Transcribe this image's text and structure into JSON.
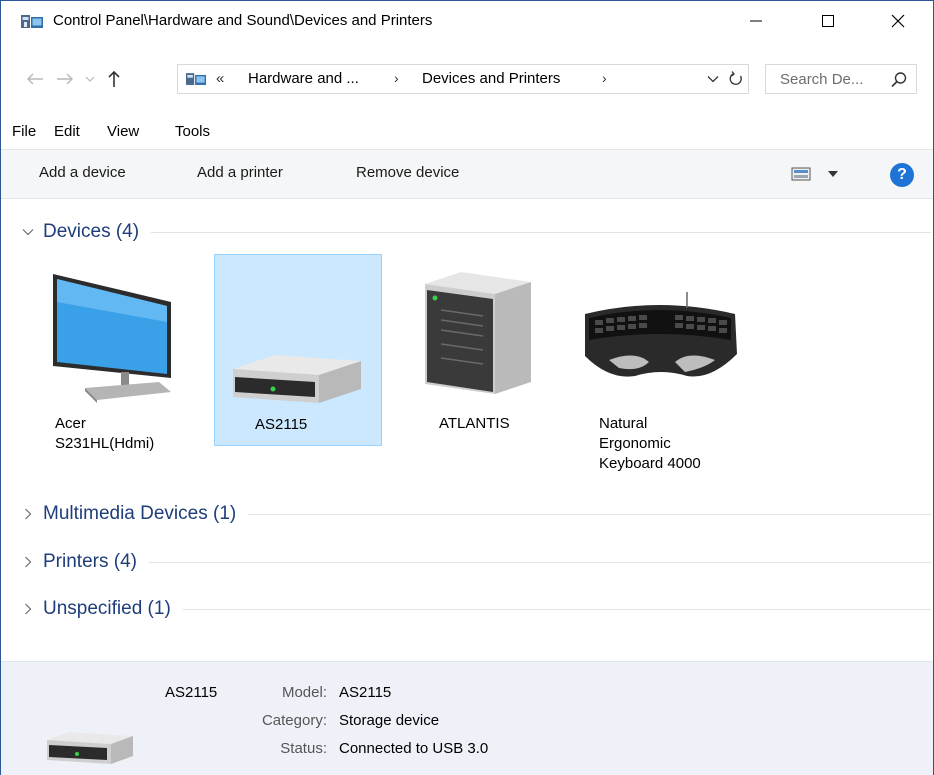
{
  "window": {
    "title": "Control Panel\\Hardware and Sound\\Devices and Printers",
    "app_icon": "control-panel-icon"
  },
  "address": {
    "overflow": "«",
    "crumbs": [
      "Hardware and ...",
      "Devices and Printers"
    ],
    "separator": "›",
    "search_placeholder": "Search De..."
  },
  "menu": [
    "File",
    "Edit",
    "View",
    "Tools"
  ],
  "commands": {
    "add_device": "Add a device",
    "add_printer": "Add a printer",
    "remove_device": "Remove device",
    "help": "?"
  },
  "groups": {
    "devices": "Devices (4)",
    "multimedia": "Multimedia Devices (1)",
    "printers": "Printers (4)",
    "unspecified": "Unspecified (1)"
  },
  "devices": [
    {
      "name": "Acer S231HL(Hdmi)",
      "lines": [
        "Acer",
        "S231HL(Hdmi)"
      ],
      "icon": "monitor-icon"
    },
    {
      "name": "AS2115",
      "lines": [
        "AS2115"
      ],
      "icon": "external-drive-icon",
      "selected": true
    },
    {
      "name": "ATLANTIS",
      "lines": [
        "ATLANTIS"
      ],
      "icon": "computer-tower-icon"
    },
    {
      "name": "Natural Ergonomic Keyboard 4000",
      "lines": [
        "Natural",
        "Ergonomic",
        "Keyboard 4000"
      ],
      "icon": "keyboard-icon"
    }
  ],
  "details": {
    "name": "AS2115",
    "model_label": "Model:",
    "model": "AS2115",
    "category_label": "Category:",
    "category": "Storage device",
    "status_label": "Status:",
    "status": "Connected to USB 3.0"
  },
  "colors": {
    "selection_bg": "#cce8ff",
    "selection_border": "#99d1ff",
    "group_header": "#1e3d7a",
    "details_bg": "#eef2f8",
    "help_button": "#1e73d6"
  }
}
